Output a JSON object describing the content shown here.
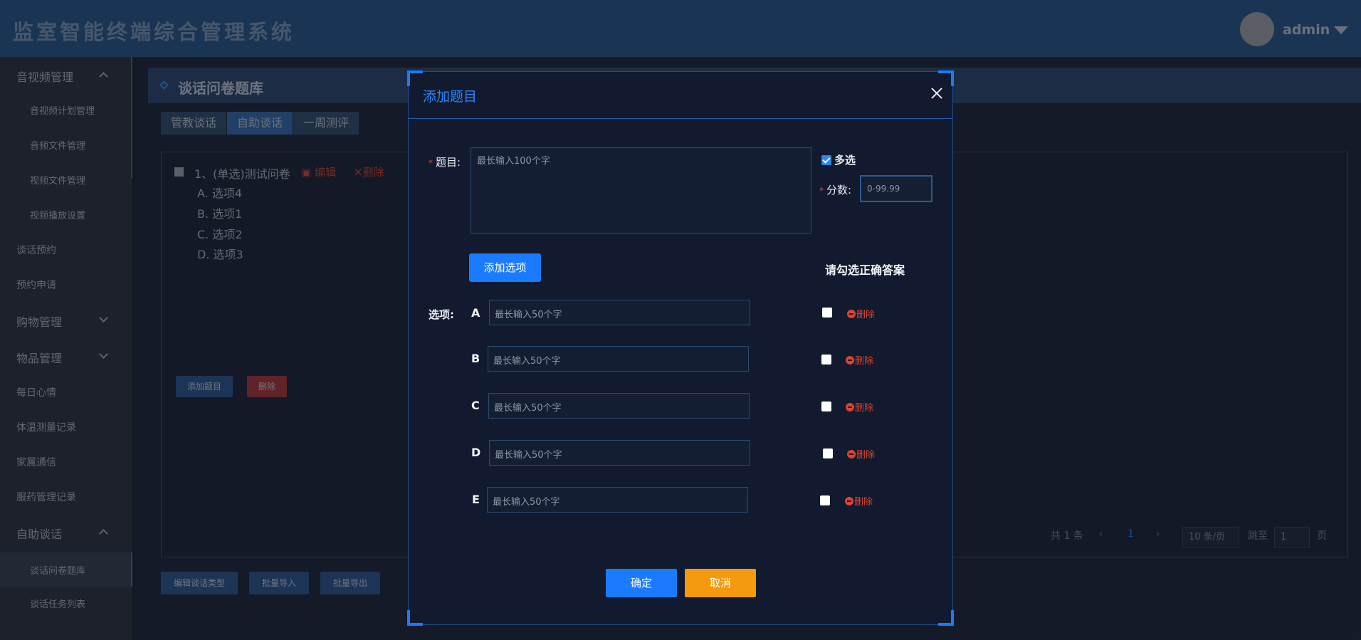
{
  "header": {
    "title": "监室智能终端综合管理系统",
    "user": "admin"
  },
  "sidebar": {
    "items": [
      {
        "label": "音视频管理",
        "expanded": true
      },
      {
        "label": "音视频计划管理"
      },
      {
        "label": "音频文件管理"
      },
      {
        "label": "视频文件管理"
      },
      {
        "label": "视频播放设置"
      },
      {
        "label": "谈话预约"
      },
      {
        "label": "预约申请"
      },
      {
        "label": "购物管理",
        "expanded": false
      },
      {
        "label": "物品管理",
        "expanded": false
      },
      {
        "label": "每日心情"
      },
      {
        "label": "体温测量记录"
      },
      {
        "label": "家属通信"
      },
      {
        "label": "服药管理记录"
      },
      {
        "label": "自助谈话",
        "expanded": true
      },
      {
        "label": "谈话问卷题库",
        "active": true
      },
      {
        "label": "谈话任务列表"
      }
    ]
  },
  "page": {
    "title": "谈话问卷题库",
    "tabs": [
      "管教谈话",
      "自助谈话",
      "一周测评"
    ],
    "active_tab": "自助谈话",
    "question": {
      "title": "1、(单选)测试问卷",
      "edit": "编辑",
      "delete": "删除",
      "options": [
        "A. 选项4",
        "B. 选项1",
        "C. 选项2",
        "D. 选项3"
      ]
    },
    "footer_buttons": {
      "add": "添加题目",
      "delete": "删除"
    },
    "pager": {
      "total": "共 1 条",
      "current": "1",
      "page_size": "10 条/页",
      "jump_label": "跳至",
      "jump_value": "1",
      "page_unit": "页"
    },
    "bottom_buttons": [
      "编辑谈话类型",
      "批量导入",
      "批量导出"
    ]
  },
  "modal": {
    "title": "添加题目",
    "question_label": "题目:",
    "question_placeholder": "最长输入100个字",
    "multi_label": "多选",
    "multi_checked": true,
    "score_label": "分数:",
    "score_placeholder": "0-99.99",
    "add_option": "添加选项",
    "answer_hint": "请勾选正确答案",
    "options_label": "选项:",
    "options": [
      {
        "letter": "A",
        "placeholder": "最长输入50个字",
        "delete": "删除"
      },
      {
        "letter": "B",
        "placeholder": "最长输入50个字",
        "delete": "删除"
      },
      {
        "letter": "C",
        "placeholder": "最长输入50个字",
        "delete": "删除"
      },
      {
        "letter": "D",
        "placeholder": "最长输入50个字",
        "delete": "删除"
      },
      {
        "letter": "E",
        "placeholder": "最长输入50个字",
        "delete": "删除"
      }
    ],
    "confirm": "确定",
    "cancel": "取消"
  },
  "colors": {
    "primary": "#1a7bff",
    "warning": "#f59a0c",
    "danger": "#e1412e",
    "header_bg": "#2b5a8d"
  }
}
